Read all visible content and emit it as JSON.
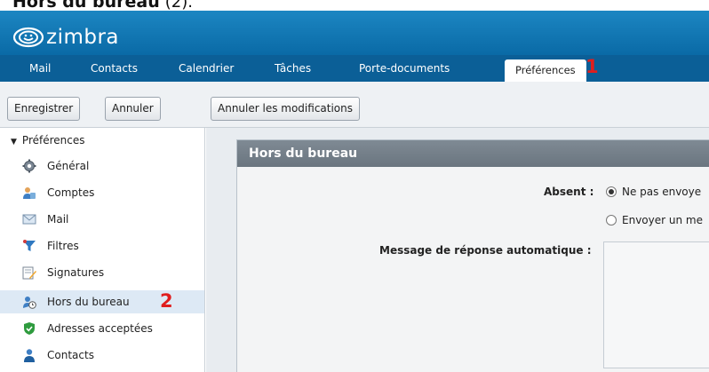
{
  "page_heading": {
    "title": "Hors du bureau",
    "suffix": "(2)."
  },
  "app": {
    "logo_text": "zimbra"
  },
  "tabs": [
    {
      "label": "Mail"
    },
    {
      "label": "Contacts"
    },
    {
      "label": "Calendrier"
    },
    {
      "label": "Tâches"
    },
    {
      "label": "Porte-documents"
    },
    {
      "label": "Préférences",
      "active": true
    }
  ],
  "annotations": {
    "tab_marker": "1",
    "sidebar_marker": "2",
    "color": "#e01e1e"
  },
  "toolbar": {
    "save_label": "Enregistrer",
    "cancel_label": "Annuler",
    "revert_label": "Annuler les modifications"
  },
  "sidebar": {
    "header": "Préférences",
    "items": [
      {
        "label": "Général",
        "icon": "gear-icon"
      },
      {
        "label": "Comptes",
        "icon": "accounts-icon"
      },
      {
        "label": "Mail",
        "icon": "envelope-icon"
      },
      {
        "label": "Filtres",
        "icon": "filter-icon"
      },
      {
        "label": "Signatures",
        "icon": "signature-icon"
      },
      {
        "label": "Hors du bureau",
        "icon": "out-of-office-icon",
        "selected": true
      },
      {
        "label": "Adresses acceptées",
        "icon": "shield-icon"
      },
      {
        "label": "Contacts",
        "icon": "contact-person-icon"
      }
    ]
  },
  "panel": {
    "title": "Hors du bureau",
    "absent_label": "Absent :",
    "options": [
      {
        "label": "Ne pas envoye",
        "selected": true
      },
      {
        "label": "Envoyer un me",
        "selected": false
      }
    ],
    "auto_reply_label": "Message de réponse automatique :"
  },
  "colors": {
    "header": "#0a6aa6",
    "tabbar": "#0b5f97",
    "panel_title": "#737e88",
    "selected_row": "#dde9f5"
  }
}
